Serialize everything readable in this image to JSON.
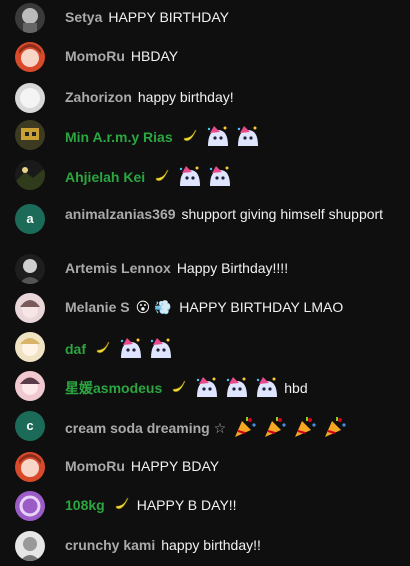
{
  "messages": [
    {
      "author": "Setya",
      "text": "HAPPY BIRTHDAY",
      "member": false,
      "avatar": "photo-dark",
      "emotes": 0
    },
    {
      "author": "MomoRu",
      "text": "HBDAY",
      "member": false,
      "avatar": "anime-orange",
      "emotes": 0
    },
    {
      "author": "Zahorizon",
      "text": "happy birthday!",
      "member": false,
      "avatar": "photo-white",
      "emotes": 0
    },
    {
      "author": "Min A.r.m.y Rias",
      "text": "",
      "member": true,
      "avatar": "pixel-art",
      "emotes": 2
    },
    {
      "author": "Ahjielah Kei",
      "text": "",
      "member": true,
      "avatar": "landscape",
      "emotes": 2
    },
    {
      "author": "animalzanias369",
      "text": "shupport giving himself shupport",
      "member": false,
      "avatar": "letter",
      "letter": "a",
      "avatar_color": "#1c6b59",
      "emotes": 0
    },
    {
      "author": "Artemis Lennox",
      "text": "Happy Birthday!!!!",
      "member": false,
      "avatar": "photo-bw",
      "emotes": 0
    },
    {
      "author": "Melanie S",
      "text": "HAPPY BIRTHDAY LMAO",
      "member": false,
      "avatar": "anime-pink",
      "emotes": 0,
      "emoji_after_name": "😮 💨"
    },
    {
      "author": "daf",
      "text": "",
      "member": true,
      "avatar": "anime-light",
      "emotes": 2
    },
    {
      "author": "星媛asmodeus",
      "text": "hbd",
      "member": true,
      "avatar": "anime-pink2",
      "emotes": 3
    },
    {
      "author": "cream soda dreaming ☆",
      "text": "",
      "member": false,
      "avatar": "letter",
      "letter": "c",
      "avatar_color": "#1c6b59",
      "emotes": 0,
      "party": 4
    },
    {
      "author": "MomoRu",
      "text": "HAPPY BDAY",
      "member": false,
      "avatar": "anime-orange",
      "emotes": 0
    },
    {
      "author": "108kg",
      "text": "HAPPY B DAY!!",
      "member": true,
      "avatar": "purple-swirl",
      "emotes": 0
    },
    {
      "author": "crunchy kami",
      "text": "happy birthday!!",
      "member": false,
      "avatar": "photo-white2",
      "emotes": 0
    }
  ],
  "colors": {
    "member_name": "#2ba640",
    "name": "#aaaaaa",
    "text": "#f1f1f1",
    "background": "#0f0f0f"
  },
  "icons": {
    "member_badge": "banana-icon",
    "emote": "party-ghost-emote",
    "party": "party-popper-icon"
  }
}
